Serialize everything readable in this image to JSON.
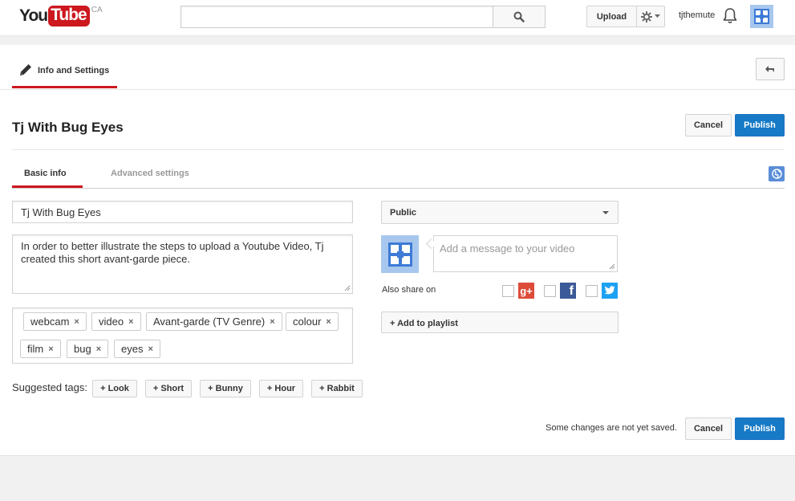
{
  "masthead": {
    "logo_you": "You",
    "logo_tube": "Tube",
    "logo_country": "CA",
    "search_value": "",
    "upload_label": "Upload",
    "username": "tjthemute"
  },
  "section": {
    "tab_label": "Info and Settings"
  },
  "video": {
    "title": "Tj With Bug Eyes",
    "cancel_label": "Cancel",
    "publish_label": "Publish"
  },
  "tabs": {
    "basic": "Basic info",
    "advanced": "Advanced settings"
  },
  "form": {
    "title_value": "Tj With Bug Eyes",
    "description_value": "In order to better illustrate the steps to upload a Youtube Video, Tj created this short avant-garde piece.",
    "tags": [
      "webcam",
      "video",
      "Avant-garde (TV Genre)",
      "colour",
      "film",
      "bug",
      "eyes"
    ],
    "tag_remove_glyph": "×",
    "suggested_label": "Suggested tags:",
    "suggested_tags": [
      "+ Look",
      "+ Short",
      "+ Bunny",
      "+ Hour",
      "+ Rabbit"
    ]
  },
  "sidebar": {
    "privacy_value": "Public",
    "message_placeholder": "Add a message to your video",
    "share_label": "Also share on",
    "share_networks": [
      "google-plus",
      "facebook",
      "twitter"
    ],
    "playlist_label": "+ Add to playlist"
  },
  "footer": {
    "unsaved_text": "Some changes are not yet saved.",
    "cancel_label": "Cancel",
    "publish_label": "Publish"
  },
  "colors": {
    "brand_red": "#cc181e",
    "publish_blue": "#167ac6",
    "google_red": "#dd4b39",
    "facebook_blue": "#3b5998",
    "twitter_blue": "#1da1f2"
  }
}
